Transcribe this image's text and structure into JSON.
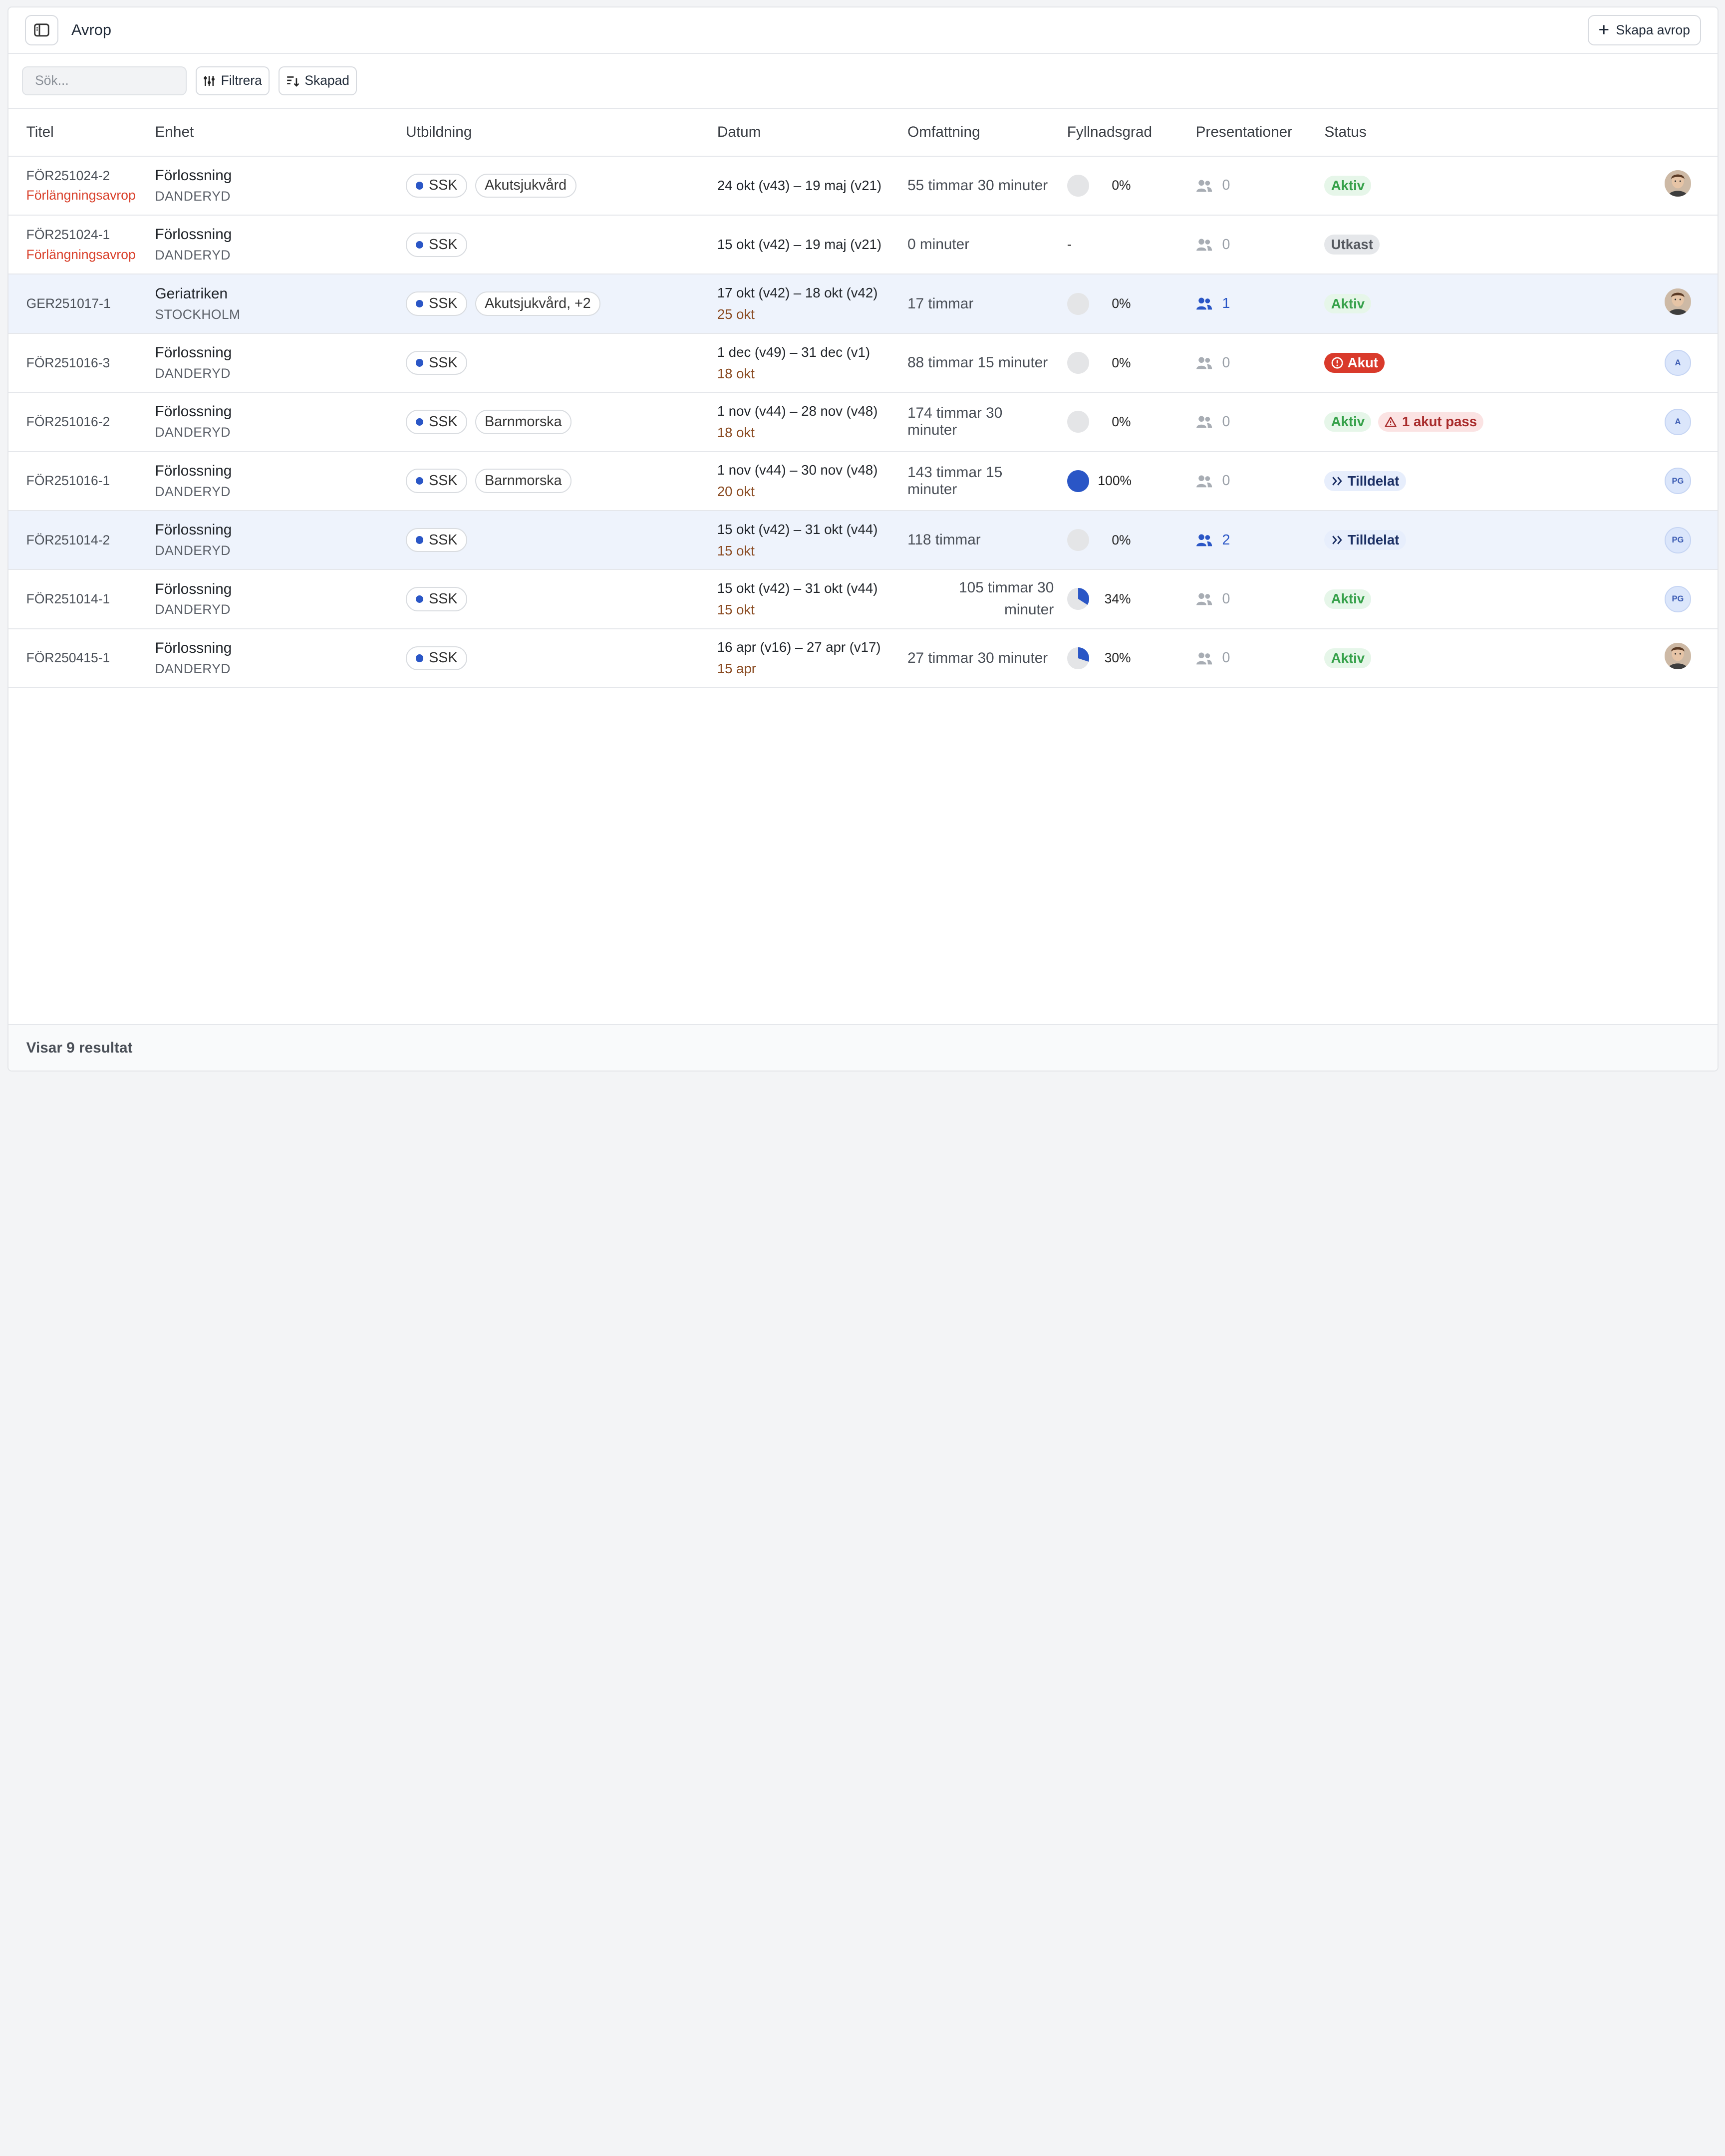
{
  "header": {
    "title": "Avrop",
    "create_label": "Skapa avrop"
  },
  "toolbar": {
    "search_placeholder": "Sök...",
    "filter_label": "Filtrera",
    "sort_label": "Skapad"
  },
  "columns": [
    "Titel",
    "Enhet",
    "Utbildning",
    "Datum",
    "Omfattning",
    "Fyllnadsgrad",
    "Presentationer",
    "Status"
  ],
  "rows": [
    {
      "id": "FÖR251024-2",
      "ext": "Förlängningsavrop",
      "unit": "Förlossning",
      "city": "DANDERYD",
      "edu": [
        "SSK",
        "Akutsjukvård"
      ],
      "date": "24 okt (v43) – 19 maj (v21)",
      "date_sub": "",
      "scope": "55 timmar 30 minuter",
      "fill": 0,
      "fill_label": "0%",
      "pres": "0",
      "status": "Aktiv",
      "avatar": "photo"
    },
    {
      "id": "FÖR251024-1",
      "ext": "Förlängningsavrop",
      "unit": "Förlossning",
      "city": "DANDERYD",
      "edu": [
        "SSK"
      ],
      "date": "15 okt (v42) – 19 maj (v21)",
      "date_sub": "",
      "scope": "0 minuter",
      "fill": null,
      "fill_label": "-",
      "pres": "0",
      "status": "Utkast",
      "avatar": ""
    },
    {
      "id": "GER251017-1",
      "ext": "",
      "unit": "Geriatriken",
      "city": "STOCKHOLM",
      "edu": [
        "SSK",
        "Akutsjukvård, +2"
      ],
      "date": "17 okt (v42) – 18 okt (v42)",
      "date_sub": "25 okt",
      "scope": "17 timmar",
      "fill": 0,
      "fill_label": "0%",
      "pres": "1",
      "status": "Aktiv",
      "avatar": "photo"
    },
    {
      "id": "FÖR251016-3",
      "ext": "",
      "unit": "Förlossning",
      "city": "DANDERYD",
      "edu": [
        "SSK"
      ],
      "date": "1 dec (v49) – 31 dec (v1)",
      "date_sub": "18 okt",
      "scope": "88 timmar 15 minuter",
      "fill": 0,
      "fill_label": "0%",
      "pres": "0",
      "status": "Akut",
      "avatar": "A"
    },
    {
      "id": "FÖR251016-2",
      "ext": "",
      "unit": "Förlossning",
      "city": "DANDERYD",
      "edu": [
        "SSK",
        "Barnmorska"
      ],
      "date": "1 nov (v44) – 28 nov (v48)",
      "date_sub": "18 okt",
      "scope": "174 timmar 30 minuter",
      "fill": 0,
      "fill_label": "0%",
      "pres": "0",
      "status": "Aktiv",
      "warning": "1 akut pass",
      "avatar": "A"
    },
    {
      "id": "FÖR251016-1",
      "ext": "",
      "unit": "Förlossning",
      "city": "DANDERYD",
      "edu": [
        "SSK",
        "Barnmorska"
      ],
      "date": "1 nov (v44) – 30 nov (v48)",
      "date_sub": "20 okt",
      "scope": "143 timmar 15 minuter",
      "fill": 1,
      "fill_label": "100%",
      "pres": "0",
      "status": "Tilldelat",
      "avatar": "PG"
    },
    {
      "id": "FÖR251014-2",
      "ext": "",
      "unit": "Förlossning",
      "city": "DANDERYD",
      "edu": [
        "SSK"
      ],
      "date": "15 okt (v42) – 31 okt (v44)",
      "date_sub": "15 okt",
      "scope": "118 timmar",
      "fill": 0,
      "fill_label": "0%",
      "pres": "2",
      "status": "Tilldelat",
      "avatar": "PG"
    },
    {
      "id": "FÖR251014-1",
      "ext": "",
      "unit": "Förlossning",
      "city": "DANDERYD",
      "edu": [
        "SSK"
      ],
      "date": "15 okt (v42) – 31 okt (v44)",
      "date_sub": "15 okt",
      "scope": "105 timmar 30 minuter",
      "fill": 0.34,
      "fill_label": "34%",
      "pres": "0",
      "status": "Aktiv",
      "avatar": "PG"
    },
    {
      "id": "FÖR250415-1",
      "ext": "",
      "unit": "Förlossning",
      "city": "DANDERYD",
      "edu": [
        "SSK"
      ],
      "date": "16 apr (v16) – 27 apr (v17)",
      "date_sub": "15 apr",
      "scope": "27 timmar 30 minuter",
      "fill": 0.3,
      "fill_label": "30%",
      "pres": "0",
      "status": "Aktiv",
      "avatar": "photo"
    }
  ],
  "footer": {
    "results": "Visar 9 resultat"
  }
}
